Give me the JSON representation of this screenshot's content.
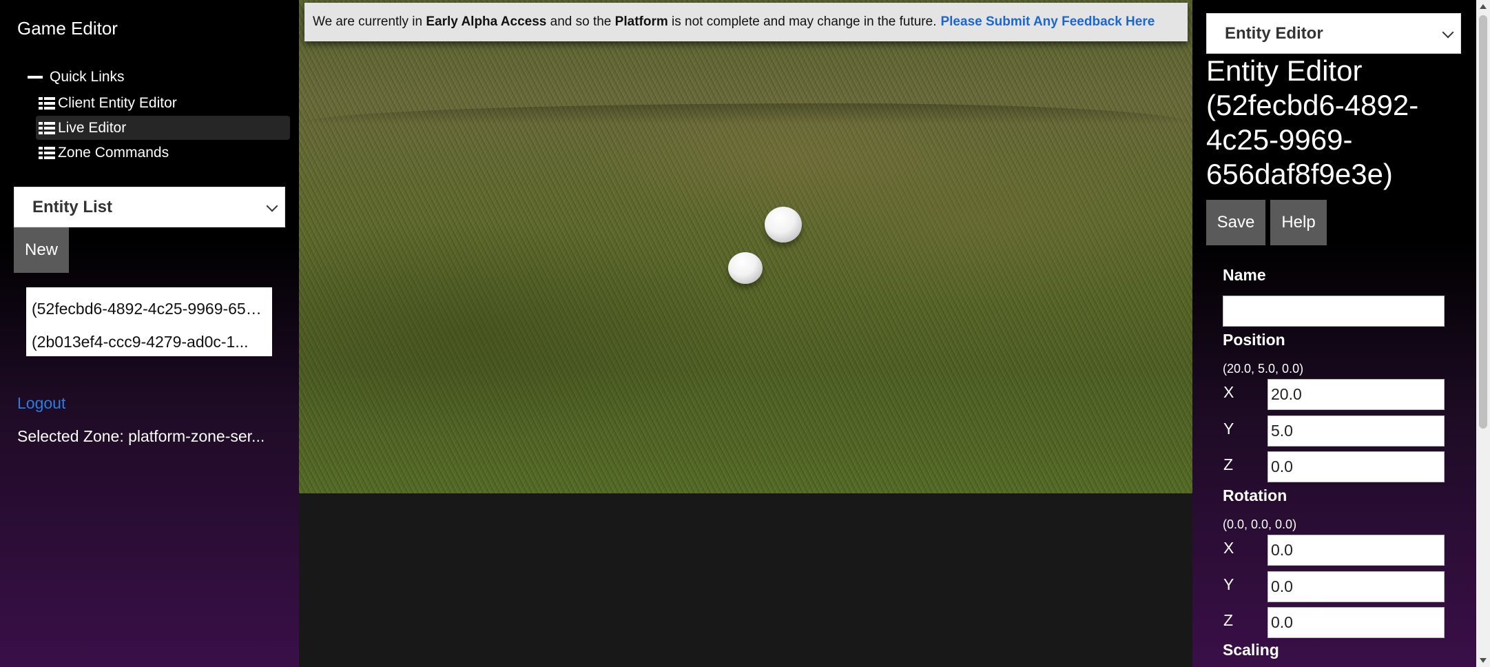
{
  "app_title": "Game Editor",
  "quick_links": {
    "header": "Quick Links",
    "items": [
      {
        "label": "Client Entity Editor",
        "icon": "list-icon"
      },
      {
        "label": "Live Editor",
        "icon": "list-icon",
        "active": true
      },
      {
        "label": "Zone Commands",
        "icon": "list-icon"
      }
    ]
  },
  "entity_list_select": {
    "value": "Entity List"
  },
  "new_button": "New",
  "entities": [
    "(52fecbd6-4892-4c25-9969-656daf8f9e3e)",
    "(2b013ef4-ccc9-4279-ad0c-1..."
  ],
  "logout": "Logout",
  "selected_zone": "Selected Zone: platform-zone-ser...",
  "banner": {
    "prefix": "We are currently in",
    "bold1": "Early Alpha Access",
    "middle": "and so the",
    "bold2": "Platform",
    "suffix": "is not complete and may change in the future.",
    "link": "Please Submit Any Feedback Here"
  },
  "right_panel": {
    "select_value": "Entity Editor",
    "title": "Entity Editor (52fecbd6-4892-4c25-9969-656daf8f9e3e)",
    "save": "Save",
    "help": "Help",
    "name_label": "Name",
    "name_value": "",
    "position": {
      "label": "Position",
      "text": "(20.0, 5.0, 0.0)",
      "x": "20.0",
      "y": "5.0",
      "z": "0.0"
    },
    "rotation": {
      "label": "Rotation",
      "text": "(0.0, 0.0, 0.0)",
      "x": "0.0",
      "y": "0.0",
      "z": "0.0"
    },
    "scaling_label": "Scaling",
    "axis_labels": {
      "x": "X",
      "y": "Y",
      "z": "Z"
    }
  },
  "colors": {
    "link": "#2a7de1",
    "banner_link": "#1a66d2",
    "button_gray": "#5a5a5a"
  }
}
